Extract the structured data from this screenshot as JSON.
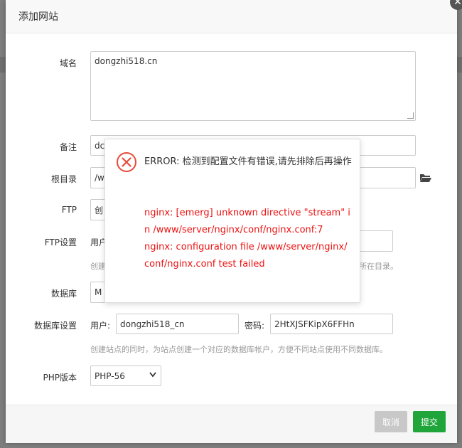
{
  "dialog": {
    "title": "添加网站",
    "close_icon": "close-icon"
  },
  "form": {
    "domain": {
      "label": "域名",
      "value": "dongzhi518.cn"
    },
    "remark": {
      "label": "备注",
      "value": "dc"
    },
    "root": {
      "label": "根目录",
      "value": "/w"
    },
    "ftp": {
      "label": "FTP",
      "value": "创"
    },
    "ftp_settings": {
      "label": "FTP设置",
      "user_label": "用户",
      "hint_prefix": "创建",
      "hint_suffix": "所在目录。"
    },
    "database": {
      "label": "数据库",
      "value": "M"
    },
    "db_settings": {
      "label": "数据库设置",
      "user_label": "用户:",
      "user_value": "dongzhi518_cn",
      "password_label": "密码:",
      "password_value": "2HtXJSFKipX6FFHn",
      "hint": "创建站点的同时，为站点创建一个对应的数据库帐户，方便不同站点使用不同数据库。"
    },
    "php": {
      "label": "PHP版本",
      "value": "PHP-56"
    }
  },
  "footer": {
    "cancel_label": "取消",
    "submit_label": "提交",
    "cancel_color": "#c8c8c8",
    "submit_color": "#20a53a"
  },
  "error": {
    "title": "ERROR: 检测到配置文件有错误,请先排除后再操作",
    "detail_line1": "nginx: [emerg] unknown directive \"stream\" in /www/server/nginx/conf/nginx.conf:7",
    "detail_line2": "nginx: configuration file /www/server/nginx/conf/nginx.conf test failed",
    "color": "#ee1111"
  }
}
